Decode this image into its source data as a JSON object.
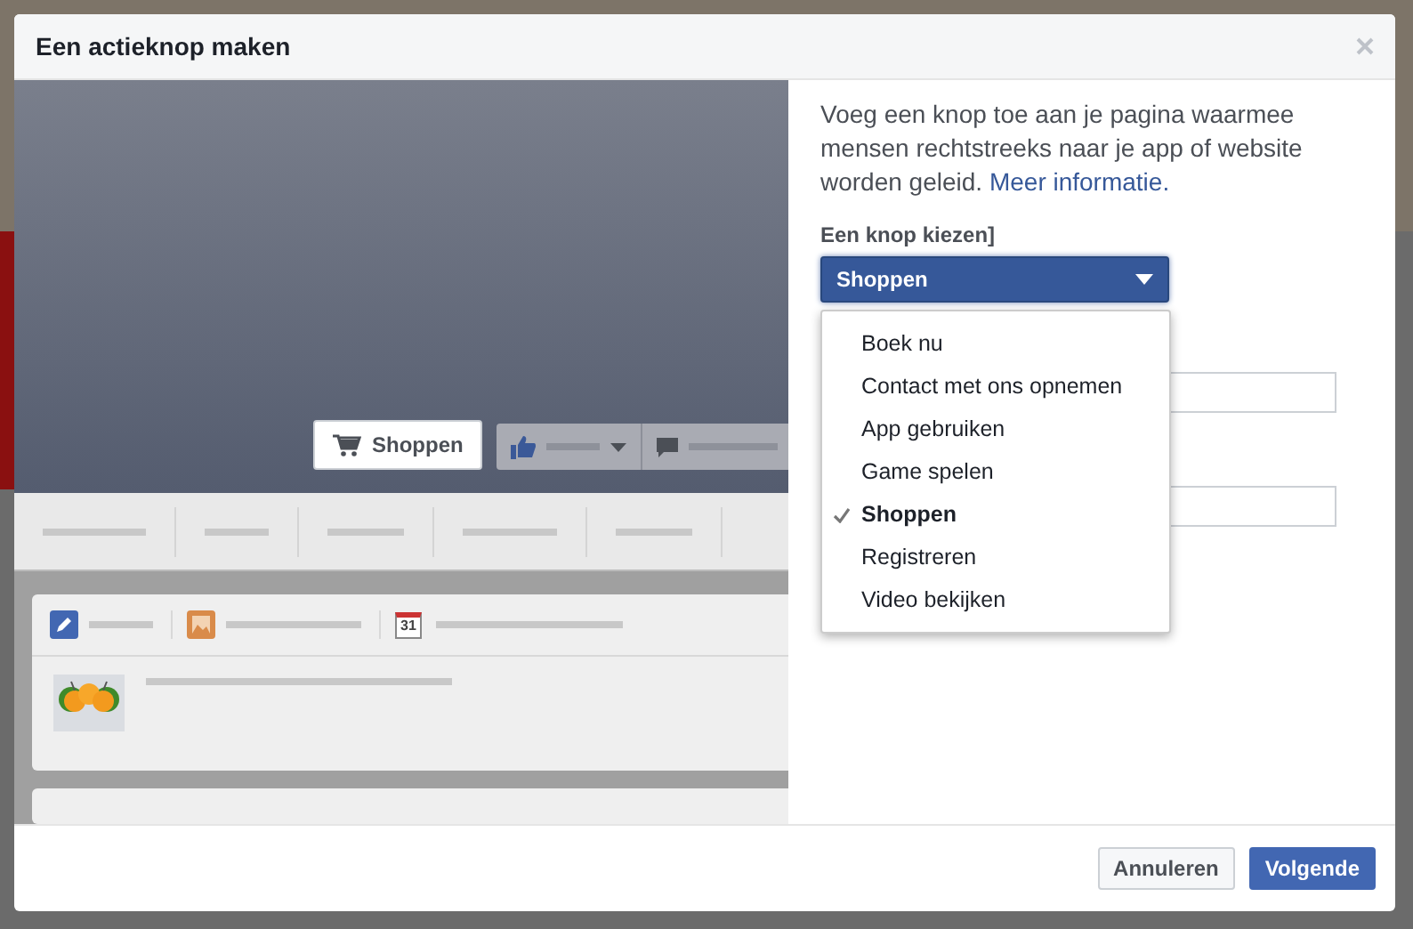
{
  "dialog": {
    "title": "Een actieknop maken"
  },
  "preview": {
    "action_button": "Shoppen",
    "calendar_day": "31"
  },
  "panel": {
    "description": "Voeg een knop toe aan je pagina waarmee mensen rechtstreeks naar je app of website worden geleid.",
    "link": "Meer informatie.",
    "select_label": "Een knop kiezen]",
    "select": {
      "value": "Shoppen",
      "expanded": true
    },
    "options": [
      {
        "label": "Boek nu",
        "selected": false
      },
      {
        "label": "Contact met ons opnemen",
        "selected": false
      },
      {
        "label": "App gebruiken",
        "selected": false
      },
      {
        "label": "Game spelen",
        "selected": false
      },
      {
        "label": "Shoppen",
        "selected": true
      },
      {
        "label": "Registreren",
        "selected": false
      },
      {
        "label": "Video bekijken",
        "selected": false
      }
    ]
  },
  "footer": {
    "buttons": [
      {
        "label": "Annuleren",
        "kind": "secondary"
      },
      {
        "label": "Volgende",
        "kind": "primary"
      }
    ]
  }
}
